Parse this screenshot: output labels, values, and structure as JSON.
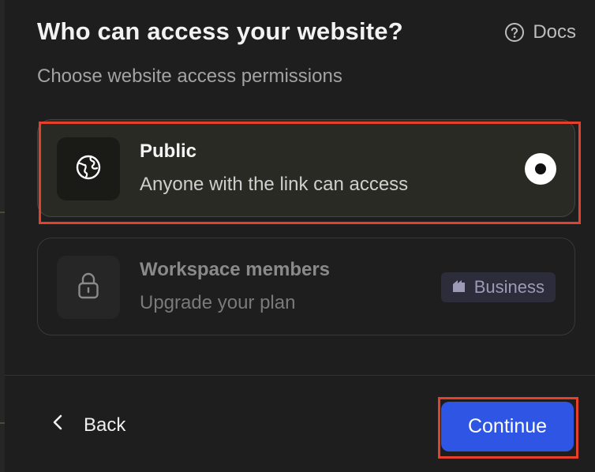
{
  "dialog": {
    "title": "Who can access your website?",
    "subtitle": "Choose website access permissions",
    "docs_label": "Docs"
  },
  "options": [
    {
      "id": "public",
      "title": "Public",
      "description": "Anyone with the link can access",
      "icon": "globe-icon",
      "selected": true
    },
    {
      "id": "workspace",
      "title": "Workspace members",
      "description": "Upgrade your plan",
      "icon": "lock-icon",
      "selected": false,
      "badge": "Business",
      "disabled": true
    }
  ],
  "footer": {
    "back_label": "Back",
    "continue_label": "Continue"
  },
  "colors": {
    "accent": "#2f55e4",
    "highlight": "#e5402c",
    "background": "#1e1e1e"
  }
}
